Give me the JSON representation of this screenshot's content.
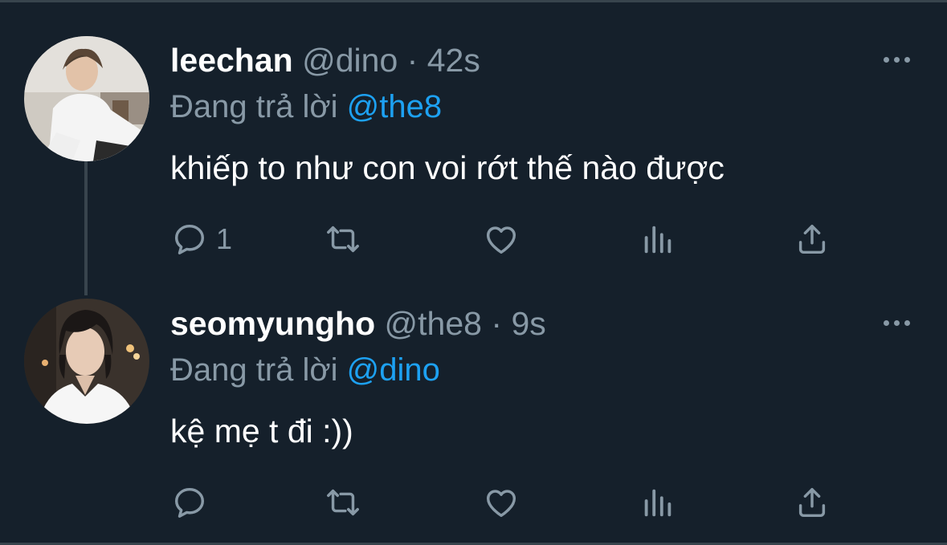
{
  "tweets": [
    {
      "display_name": "leechan",
      "handle": "@dino",
      "separator": "·",
      "time": "42s",
      "replying_prefix": "Đang trả lời",
      "replying_to": "@the8",
      "text": "khiếp to như con voi rớt thế nào được",
      "reply_count": "1"
    },
    {
      "display_name": "seomyungho",
      "handle": "@the8",
      "separator": "·",
      "time": "9s",
      "replying_prefix": "Đang trả lời",
      "replying_to": "@dino",
      "text": "kệ mẹ t đi :))",
      "reply_count": ""
    }
  ],
  "icons": [
    "avatar",
    "more-icon",
    "reply-icon",
    "retweet-icon",
    "like-icon",
    "analytics-icon",
    "share-icon"
  ],
  "colors": {
    "background": "#15202b",
    "text": "#ffffff",
    "muted": "#8899a6",
    "accent": "#1da1f2",
    "border": "#38444d"
  }
}
